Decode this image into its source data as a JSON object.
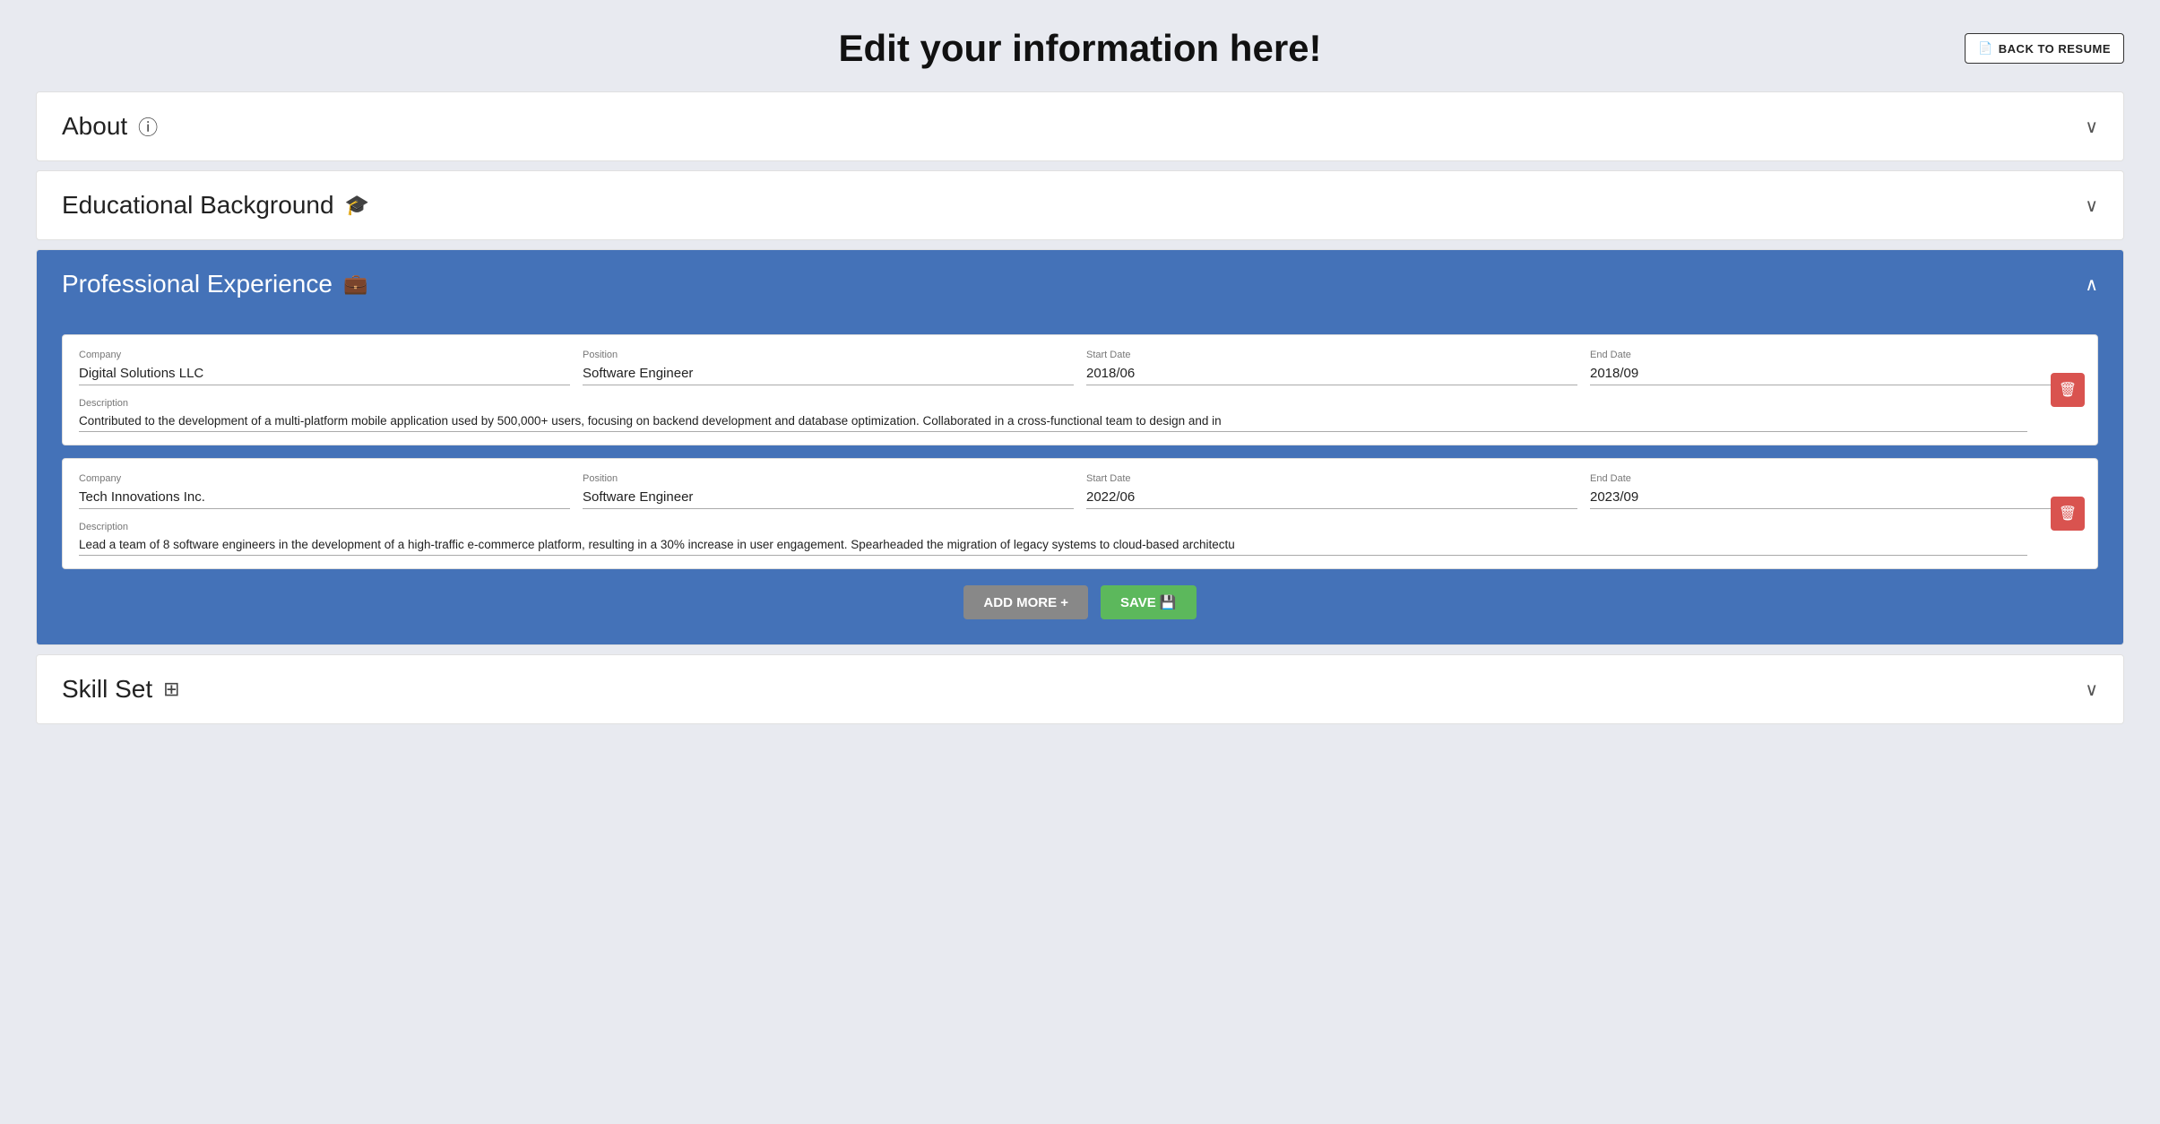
{
  "page": {
    "title": "Edit your information here!",
    "back_button_label": "BACK TO RESUME",
    "back_button_icon": "📄"
  },
  "sections": {
    "about": {
      "label": "About",
      "icon": "ⓘ",
      "expanded": false,
      "chevron": "∨"
    },
    "educational_background": {
      "label": "Educational Background",
      "icon": "🎓",
      "expanded": false,
      "chevron": "∨"
    },
    "professional_experience": {
      "label": "Professional Experience",
      "icon": "💼",
      "expanded": true,
      "chevron": "∧",
      "entries": [
        {
          "id": "entry1",
          "company_label": "Company",
          "company_value": "Digital Solutions LLC",
          "position_label": "Position",
          "position_value": "Software Engineer",
          "start_date_label": "Start Date",
          "start_date_value": "2018/06",
          "end_date_label": "End Date",
          "end_date_value": "2018/09",
          "description_label": "Description",
          "description_value": "Contributed to the development of a multi-platform mobile application used by 500,000+ users, focusing on backend development and database optimization. Collaborated in a cross-functional team to design and in"
        },
        {
          "id": "entry2",
          "company_label": "Company",
          "company_value": "Tech Innovations Inc.",
          "position_label": "Position",
          "position_value": "Software Engineer",
          "start_date_label": "Start Date",
          "start_date_value": "2022/06",
          "end_date_label": "End Date",
          "end_date_value": "2023/09",
          "description_label": "Description",
          "description_value": "Lead a team of 8 software engineers in the development of a high-traffic e-commerce platform, resulting in a 30% increase in user engagement. Spearheaded the migration of legacy systems to cloud-based architectu"
        }
      ],
      "add_more_label": "ADD MORE +",
      "save_label": "SAVE 💾"
    },
    "skill_set": {
      "label": "Skill Set",
      "icon": "⊞",
      "expanded": false,
      "chevron": "∨"
    }
  }
}
